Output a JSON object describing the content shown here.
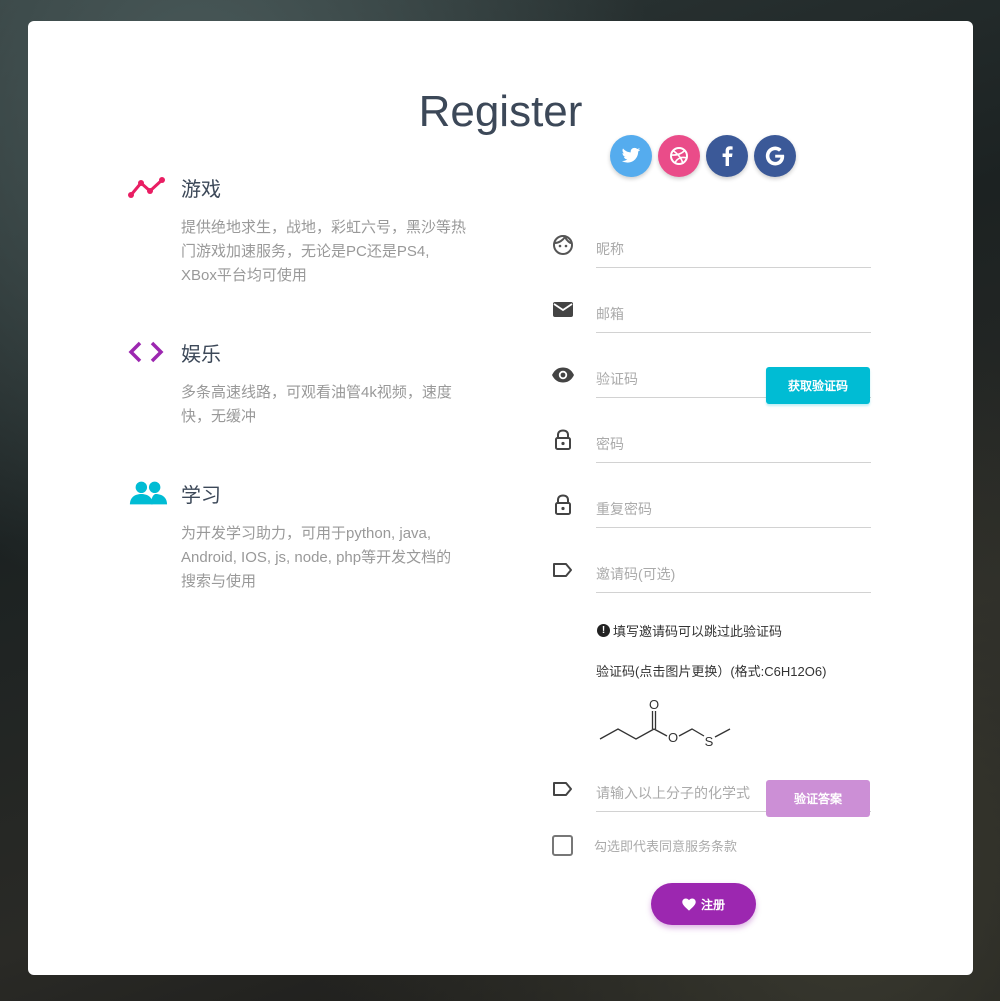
{
  "page": {
    "title": "Register"
  },
  "features": [
    {
      "name": "游戏",
      "desc": "提供绝地求生，战地，彩虹六号，黑沙等热门游戏加速服务，无论是PC还是PS4, XBox平台均可使用",
      "icon": "timeline-icon",
      "color": "#e91e63"
    },
    {
      "name": "娱乐",
      "desc": "多条高速线路，可观看油管4k视频，速度快，无缓冲",
      "icon": "code-icon",
      "color": "#9c27b0"
    },
    {
      "name": "学习",
      "desc": "为开发学习助力，可用于python, java, Android, IOS, js, node, php等开发文档的搜索与使用",
      "icon": "group-icon",
      "color": "#00bcd4"
    }
  ],
  "social": [
    {
      "name": "twitter",
      "color": "#55acee"
    },
    {
      "name": "dribbble",
      "color": "#ea4c89"
    },
    {
      "name": "facebook",
      "color": "#3b5998"
    },
    {
      "name": "google",
      "color": "#3b5998"
    }
  ],
  "form": {
    "nickname_placeholder": "昵称",
    "email_placeholder": "邮箱",
    "code_placeholder": "验证码",
    "get_code_label": "获取验证码",
    "password_placeholder": "密码",
    "repeat_password_placeholder": "重复密码",
    "invite_placeholder": "邀请码(可选)",
    "invite_hint": "填写邀请码可以跳过此验证码",
    "captcha_label": "验证码(点击图片更换）(格式:C6H12O6)",
    "formula_placeholder": "请输入以上分子的化学式",
    "verify_label": "验证答案",
    "agree_label": "勾选即代表同意服务条款",
    "submit_label": "注册"
  },
  "molecule_atoms": {
    "o_top": "O",
    "o_mid": "O",
    "s": "S"
  },
  "colors": {
    "accent_cyan": "#00bcd4",
    "accent_purple": "#9c27b0",
    "verify_button": "#cc8fd6"
  }
}
